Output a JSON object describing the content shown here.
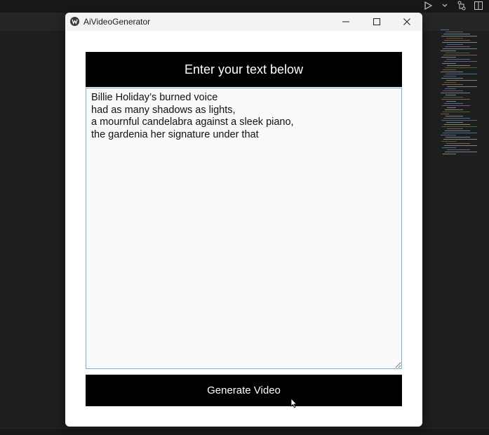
{
  "window": {
    "title": "AiVideoGenerator"
  },
  "header": {
    "text": "Enter your text below"
  },
  "editor": {
    "value": "Billie Holiday’s burned voice\nhad as many shadows as lights,\na mournful candelabra against a sleek piano,\nthe gardenia her signature under that"
  },
  "actions": {
    "generate_label": "Generate Video"
  },
  "colors": {
    "window_bg": "#ffffff",
    "bar_bg": "#000000",
    "textarea_bg": "#f9f9f9",
    "textarea_border": "#7ab0c9",
    "ide_bg": "#1e1e1e"
  },
  "icons": {
    "app": "app-logo-icon",
    "minimize": "minimize-icon",
    "maximize": "maximize-icon",
    "close": "close-icon",
    "run": "play-icon",
    "source_control": "source-control-icon",
    "layout": "split-layout-icon"
  }
}
